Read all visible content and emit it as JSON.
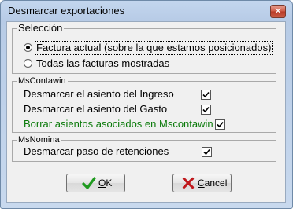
{
  "window": {
    "title": "Desmarcar exportaciones",
    "close_symbol": "✕"
  },
  "seleccion": {
    "legend": "Selección",
    "options": [
      {
        "label": "Factura actual (sobre la que estamos posicionados)",
        "selected": true
      },
      {
        "label": "Todas las facturas mostradas",
        "selected": false
      }
    ]
  },
  "mscontawin": {
    "legend": "MsContawin",
    "items": [
      {
        "label": "Desmarcar el asiento del  Ingreso",
        "checked": true
      },
      {
        "label": "Desmarcar el asiento del Gasto",
        "checked": true
      },
      {
        "label": "Borrar asientos asociados en Mscontawin",
        "checked": true
      }
    ]
  },
  "msnomina": {
    "legend": "MsNomina",
    "items": [
      {
        "label": "Desmarcar paso de retenciones",
        "checked": true
      }
    ]
  },
  "buttons": {
    "ok": {
      "mnemonic": "O",
      "rest": "K",
      "icon": "check-icon"
    },
    "cancel": {
      "mnemonic": "C",
      "rest": "ancel",
      "icon": "x-icon"
    }
  },
  "colors": {
    "green_text": "#0a7a0a",
    "check_green": "#1f9a1f",
    "cancel_red": "#c0181c",
    "close_red": "#c94a36"
  }
}
